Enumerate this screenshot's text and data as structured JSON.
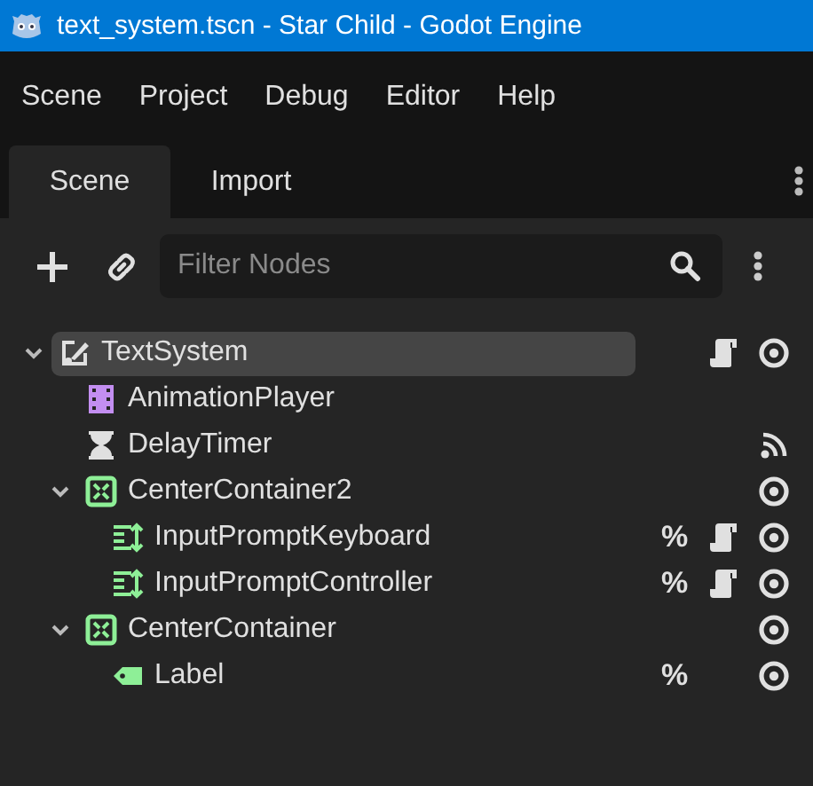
{
  "window": {
    "title": "text_system.tscn - Star Child - Godot Engine"
  },
  "menu": [
    "Scene",
    "Project",
    "Debug",
    "Editor",
    "Help"
  ],
  "tabs": [
    {
      "label": "Scene",
      "selected": true
    },
    {
      "label": "Import",
      "selected": false
    }
  ],
  "filter": {
    "placeholder": "Filter Nodes"
  },
  "tree": [
    {
      "name": "TextSystem",
      "kind": "control",
      "selected": true,
      "expanded": true,
      "script": true,
      "signals": false,
      "visible": true,
      "children": [
        {
          "name": "AnimationPlayer",
          "kind": "animation",
          "selected": false,
          "script": false,
          "signals": false
        },
        {
          "name": "DelayTimer",
          "kind": "timer",
          "selected": false,
          "script": false,
          "signals": true
        },
        {
          "name": "CenterContainer2",
          "kind": "container",
          "selected": false,
          "expanded": true,
          "script": false,
          "signals": false,
          "visible": true,
          "children": [
            {
              "name": "InputPromptKeyboard",
              "kind": "input",
              "selected": false,
              "unique_marker": "%",
              "script": true,
              "signals": false,
              "visible": true
            },
            {
              "name": "InputPromptController",
              "kind": "input",
              "selected": false,
              "unique_marker": "%",
              "script": true,
              "signals": false,
              "visible": true
            }
          ]
        },
        {
          "name": "CenterContainer",
          "kind": "container",
          "selected": false,
          "expanded": true,
          "script": false,
          "signals": false,
          "visible": true,
          "children": [
            {
              "name": "Label",
              "kind": "label",
              "selected": false,
              "unique_marker": "%",
              "script": false,
              "signals": false,
              "visible": true
            }
          ]
        }
      ]
    }
  ]
}
